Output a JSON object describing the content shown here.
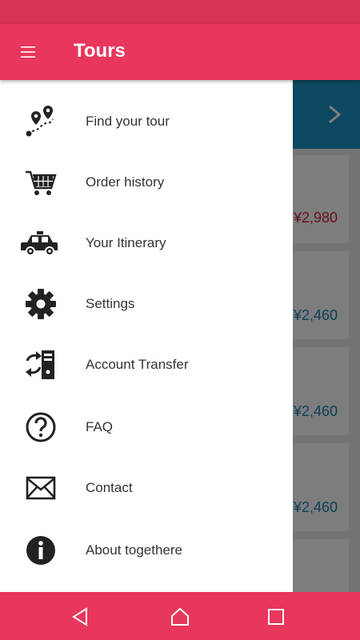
{
  "app_bar": {
    "title": "Tours",
    "menu_icon": "hamburger-menu-icon"
  },
  "drawer": {
    "items": [
      {
        "label": "Find your tour",
        "icon": "route-pin-icon"
      },
      {
        "label": "Order history",
        "icon": "shopping-cart-icon"
      },
      {
        "label": "Your Itinerary",
        "icon": "taxi-icon"
      },
      {
        "label": "Settings",
        "icon": "gear-icon"
      },
      {
        "label": "Account Transfer",
        "icon": "transfer-icon"
      },
      {
        "label": "FAQ",
        "icon": "question-icon"
      },
      {
        "label": "Contact",
        "icon": "envelope-icon"
      },
      {
        "label": "About togethere",
        "icon": "info-icon"
      }
    ]
  },
  "background": {
    "prices": [
      "¥2,980",
      "¥2,460",
      "¥2,460",
      "¥2,460"
    ],
    "price_colors": [
      "#c8243f",
      "#1a7fb0",
      "#1a7fb0",
      "#1a7fb0"
    ]
  },
  "nav_bar": {
    "back_icon": "back-triangle-icon",
    "home_icon": "home-icon",
    "recents_icon": "recents-square-icon"
  },
  "colors": {
    "accent": "#e8365c",
    "status_bar": "#d63454",
    "banner": "#1a8ec0"
  }
}
